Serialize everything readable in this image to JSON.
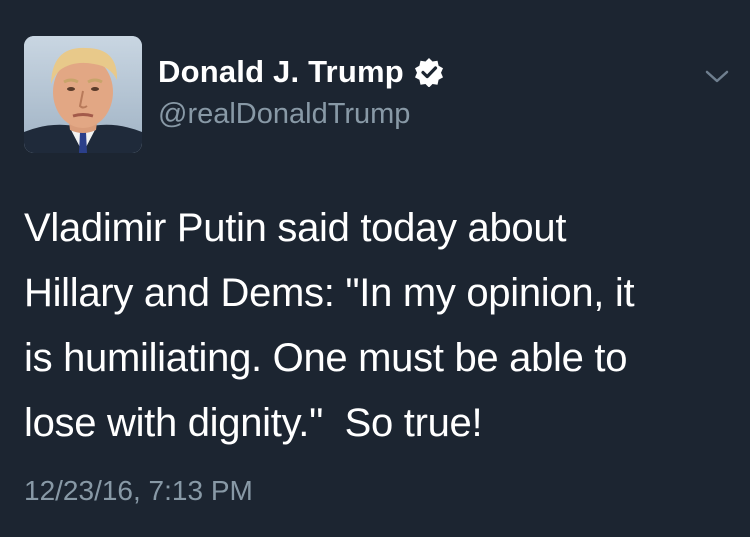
{
  "author": {
    "name": "Donald J. Trump",
    "handle": "@realDonaldTrump",
    "verified": true,
    "avatar_icon": "profile-photo"
  },
  "tweet": {
    "text": "Vladimir Putin said today about\nHillary and Dems: \"In my opinion, it\nis humiliating. One must be able to\nlose with dignity.\"  So true!",
    "timestamp": "12/23/16, 7:13 PM"
  },
  "menu": {
    "icon": "chevron-down-icon"
  },
  "colors": {
    "background": "#1c2531",
    "text": "#ffffff",
    "secondary_text": "#8899a6"
  }
}
